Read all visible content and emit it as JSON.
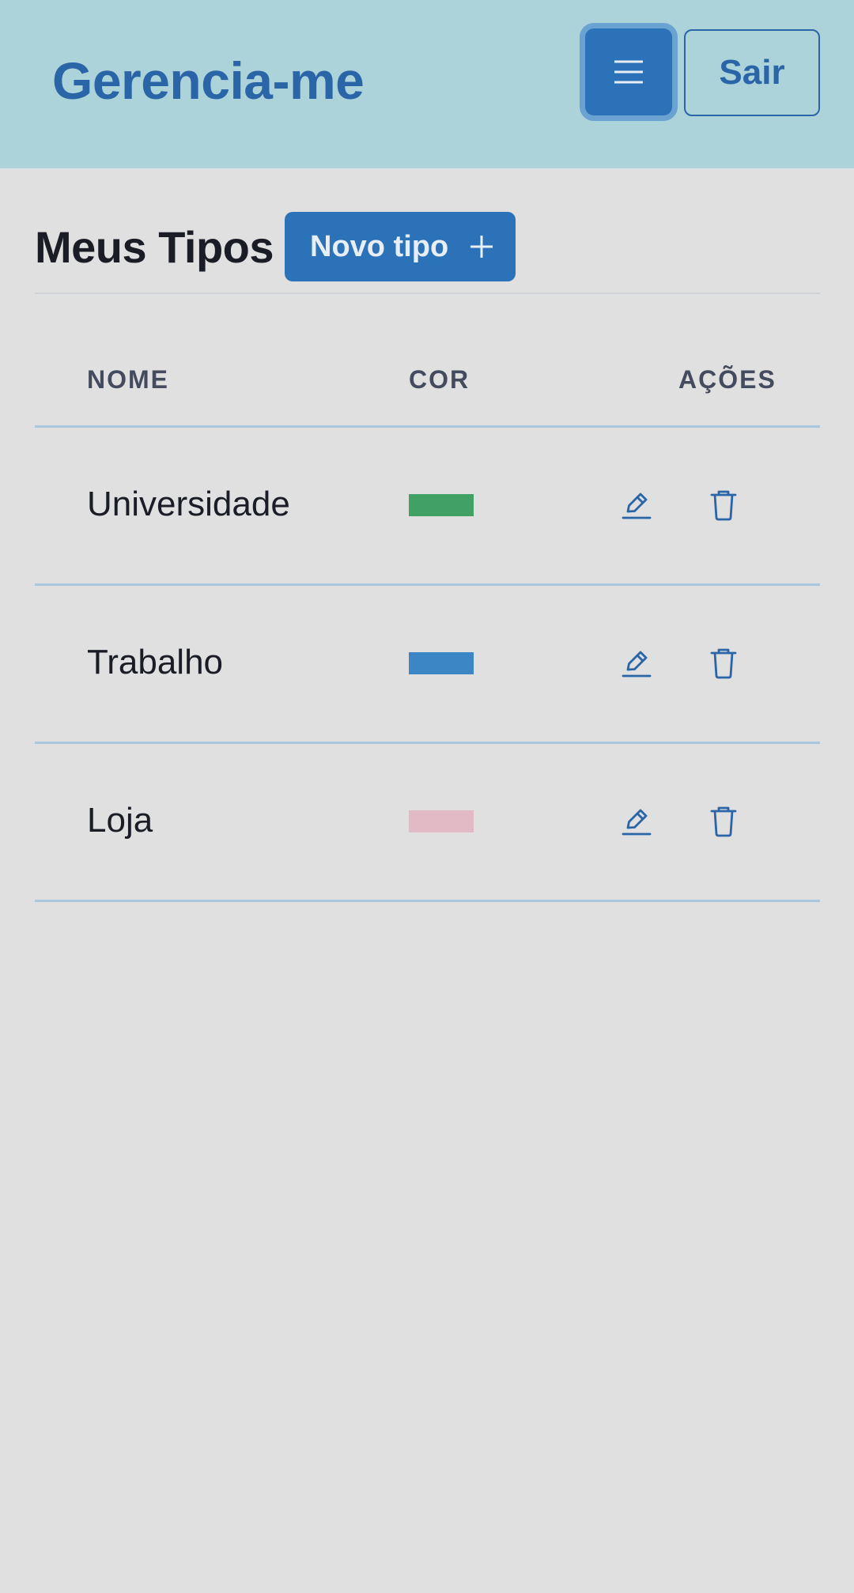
{
  "header": {
    "brand": "Gerencia-me",
    "menu_icon": "hamburger-menu-icon",
    "logout_label": "Sair"
  },
  "page": {
    "title": "Meus Tipos",
    "new_button_label": "Novo tipo",
    "new_button_icon": "plus-icon"
  },
  "table": {
    "headers": {
      "nome": "NOME",
      "cor": "COR",
      "acoes": "AÇÕES"
    },
    "rows": [
      {
        "name": "Universidade",
        "color": "#41a064"
      },
      {
        "name": "Trabalho",
        "color": "#3d86c6"
      },
      {
        "name": "Loja",
        "color": "#e2bac5"
      }
    ],
    "edit_icon": "pencil-icon",
    "delete_icon": "trash-icon"
  },
  "colors": {
    "header_bg": "#acd3da",
    "page_bg": "#e0e0e0",
    "primary": "#2c72b8",
    "brand_text": "#2a65a8"
  }
}
